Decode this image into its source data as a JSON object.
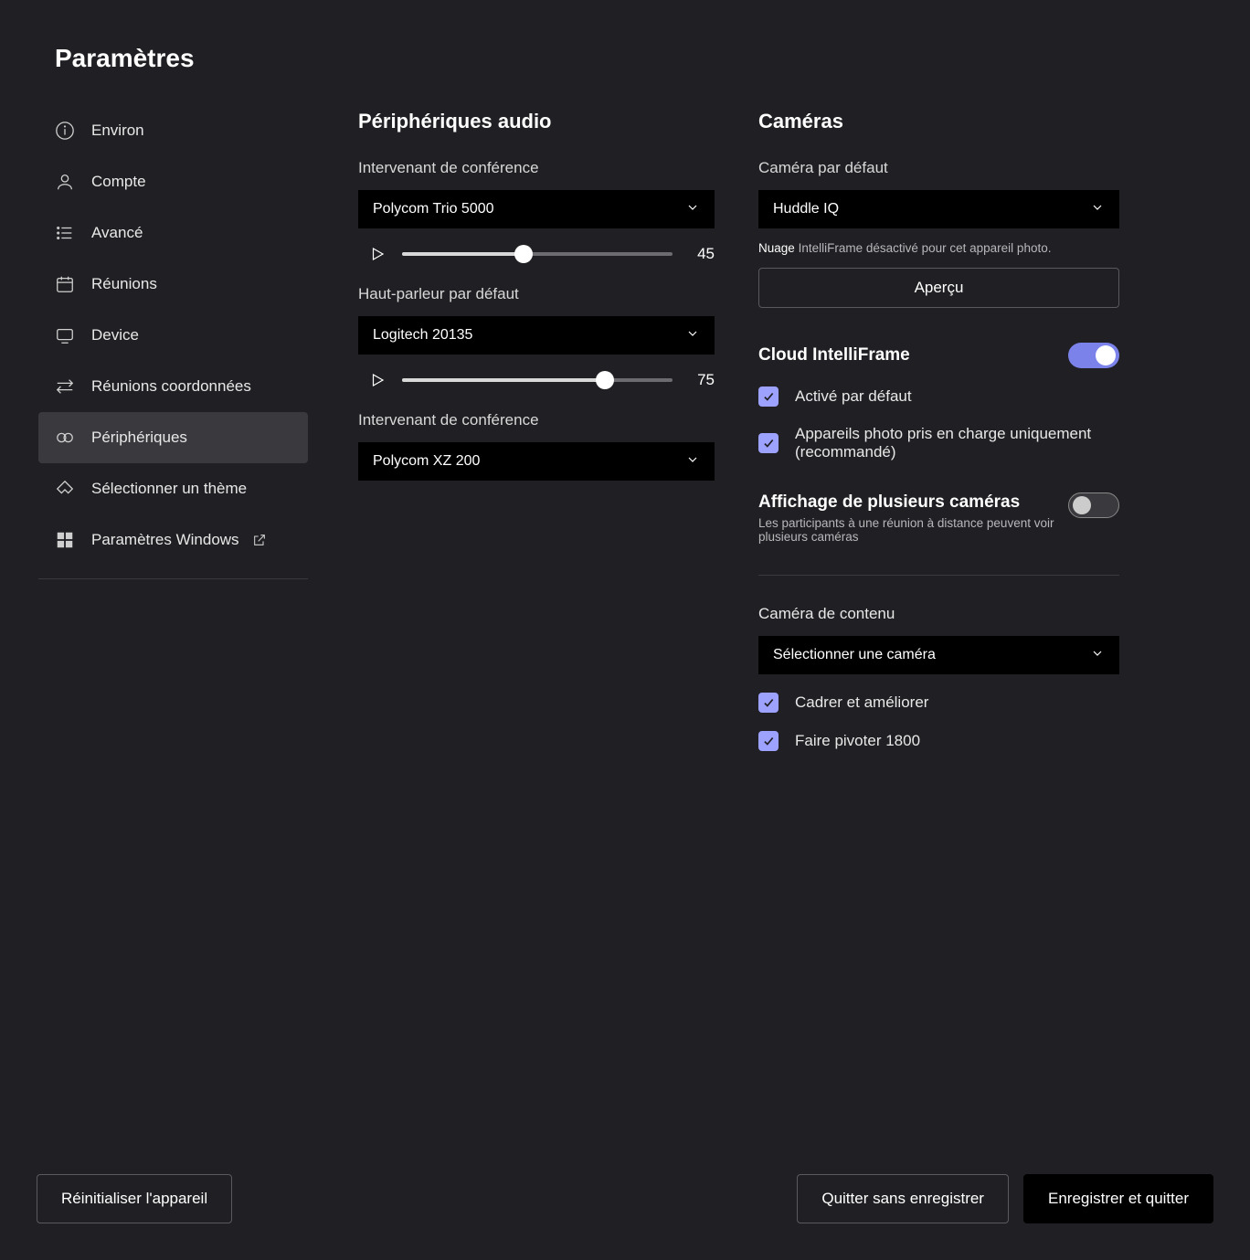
{
  "page_title": "Paramètres",
  "sidebar": {
    "items": [
      {
        "label": "Environ"
      },
      {
        "label": "Compte"
      },
      {
        "label": "Avancé"
      },
      {
        "label": "Réunions"
      },
      {
        "label": "Device"
      },
      {
        "label": "Réunions coordonnées"
      },
      {
        "label": "Périphériques"
      },
      {
        "label": "Sélectionner un thème"
      },
      {
        "label": "Paramètres Windows"
      }
    ]
  },
  "audio": {
    "title": "Périphériques audio",
    "speaker1_label": "Intervenant de conférence",
    "speaker1_value": "Polycom Trio 5000",
    "speaker1_volume": "45",
    "default_speaker_label": "Haut-parleur par défaut",
    "default_speaker_value": "Logitech 20135",
    "default_speaker_volume": "75",
    "speaker2_label": "Intervenant de conférence",
    "speaker2_value": "Polycom XZ 200"
  },
  "cameras": {
    "title": "Caméras",
    "default_label": "Caméra par défaut",
    "default_value": "Huddle IQ",
    "note_prefix": "Nuage",
    "note_rest": "IntelliFrame désactivé pour cet appareil photo.",
    "preview_label": "Aperçu",
    "intelliframe_label": "Cloud IntelliFrame",
    "cb_default_on": "Activé par défaut",
    "cb_supported_only": "Appareils photo pris en charge uniquement (recommandé)",
    "multi_title": "Affichage de plusieurs caméras",
    "multi_note": "Les participants à une réunion à distance peuvent voir plusieurs caméras",
    "content_label": "Caméra de contenu",
    "content_value": "Sélectionner une caméra",
    "cb_crop": "Cadrer et améliorer",
    "cb_rotate": "Faire pivoter 1800"
  },
  "footer": {
    "reset": "Réinitialiser l'appareil",
    "quit": "Quitter sans enregistrer",
    "save": "Enregistrer et quitter"
  }
}
